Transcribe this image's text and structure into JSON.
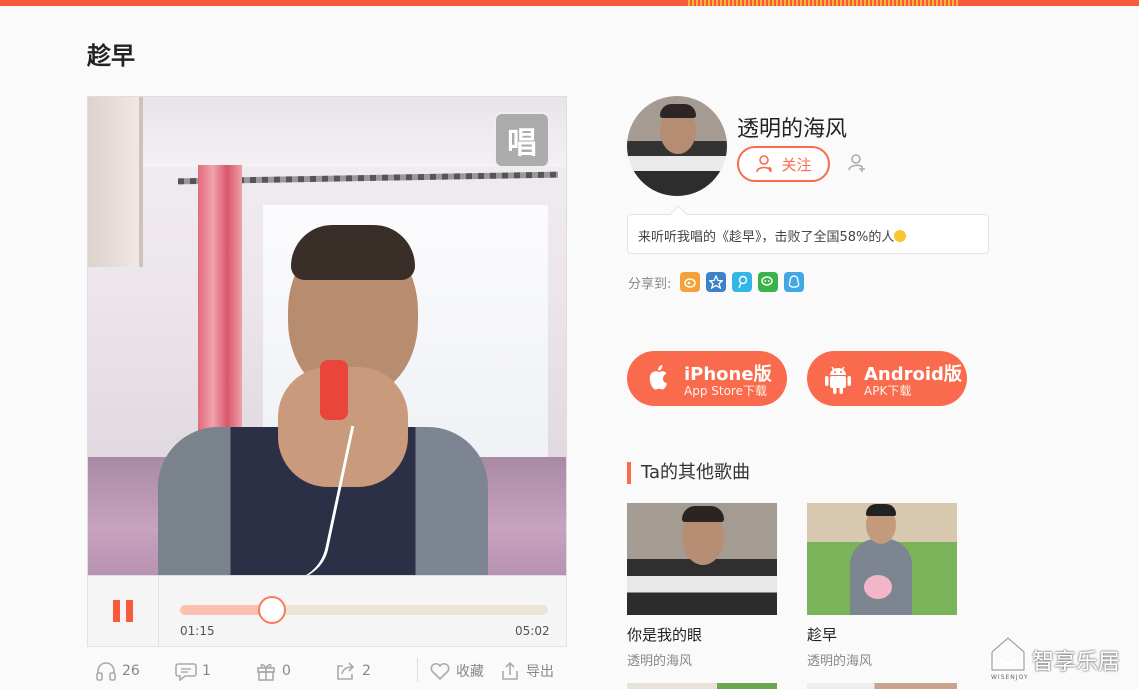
{
  "song": {
    "title": "趁早"
  },
  "video": {
    "badge": "唱"
  },
  "player": {
    "current_time": "01:15",
    "total_time": "05:02",
    "progress": 0.25,
    "state": "playing"
  },
  "stats": {
    "listens": "26",
    "comments": "1",
    "gifts": "0",
    "shares": "2",
    "collect_label": "收藏",
    "export_label": "导出"
  },
  "profile": {
    "username": "透明的海风",
    "follow_label": "关注",
    "bubble_text": "来听听我唱的《趁早》，击败了全国58%的人"
  },
  "share": {
    "label": "分享到:",
    "platforms": [
      {
        "icon": "weibo-icon",
        "color": "#f4a13a"
      },
      {
        "icon": "qzone-icon",
        "color": "#3a82c9"
      },
      {
        "icon": "tencent-weibo-icon",
        "color": "#31b6e7"
      },
      {
        "icon": "wechat-icon",
        "color": "#3cb34a"
      },
      {
        "icon": "qq-icon",
        "color": "#41a7e6"
      }
    ]
  },
  "apps": {
    "iphone": {
      "title": "iPhone版",
      "subtitle": "App Store下载"
    },
    "android": {
      "title": "Android版",
      "subtitle": "APK下载"
    }
  },
  "other_songs": {
    "heading": "Ta的其他歌曲",
    "items": [
      {
        "name": "你是我的眼",
        "author": "透明的海风"
      },
      {
        "name": "趁早",
        "author": "透明的海风"
      }
    ]
  },
  "watermark": {
    "text": "智享乐居",
    "small": "WISENJOY"
  },
  "colors": {
    "accent": "#fa5a3c",
    "button": "#fa6a4c"
  }
}
